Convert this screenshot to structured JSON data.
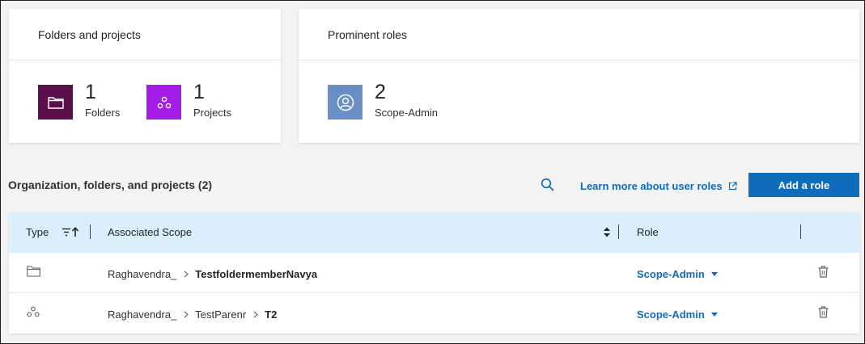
{
  "folders_card": {
    "title": "Folders and projects",
    "folders": {
      "count": "1",
      "label": "Folders",
      "icon": "folder-icon",
      "color": "#5c0e4d"
    },
    "projects": {
      "count": "1",
      "label": "Projects",
      "icon": "project-icon",
      "color": "#a51ce6"
    }
  },
  "roles_card": {
    "title": "Prominent roles",
    "role": {
      "count": "2",
      "label": "Scope-Admin",
      "icon": "user-circle-icon",
      "color": "#6a8fc7"
    }
  },
  "section": {
    "title": "Organization, folders, and projects (2)",
    "learn_more": "Learn more about user roles",
    "add_role": "Add a role"
  },
  "table": {
    "columns": [
      "Type",
      "Associated Scope",
      "Role"
    ],
    "rows": [
      {
        "type_icon": "folder-icon",
        "path": [
          "Raghavendra_"
        ],
        "leaf": "TestfoldermemberNavya",
        "role": "Scope-Admin"
      },
      {
        "type_icon": "project-icon",
        "path": [
          "Raghavendra_",
          "TestParenr"
        ],
        "leaf": "T2",
        "role": "Scope-Admin"
      }
    ]
  },
  "colors": {
    "accent": "#0f6cbd",
    "header_bg": "#dbeefb"
  }
}
